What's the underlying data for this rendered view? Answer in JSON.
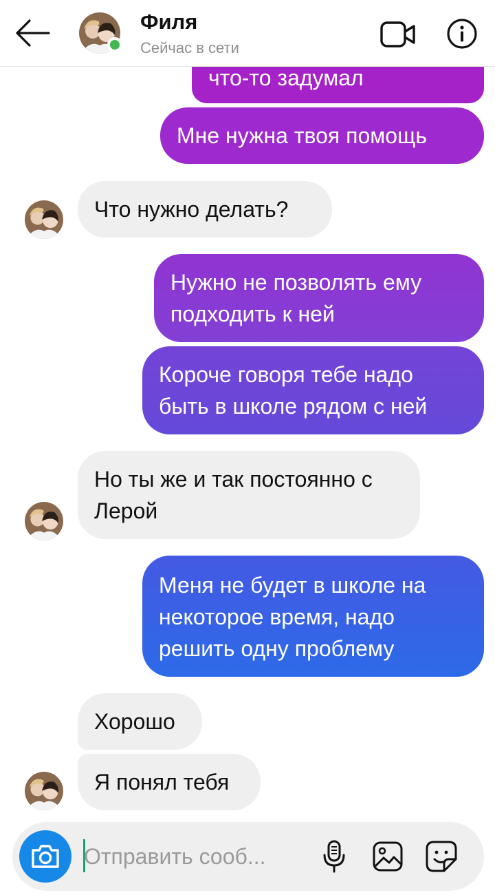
{
  "header": {
    "contact_name": "Филя",
    "status": "Сейчас в сети"
  },
  "messages": [
    {
      "side": "out",
      "text": "что-то задумал",
      "color": "#a522c9"
    },
    {
      "side": "out",
      "text": "Мне нужна твоя помощь",
      "color": "#9d29cf"
    },
    {
      "side": "in",
      "text": "Что нужно делать?"
    },
    {
      "side": "out",
      "text": "Нужно не позволять ему подходить к ней",
      "color": "#8a3bd4"
    },
    {
      "side": "out",
      "text": "Короче говоря тебе надо быть в школе рядом с ней",
      "color": "#6e46d8"
    },
    {
      "side": "in",
      "text": "Но ты же и так постоянно с Лерой"
    },
    {
      "side": "out",
      "text": "Меня не будет в школе на некоторое время, надо решить одну проблему",
      "color": "#3a62e5"
    },
    {
      "side": "in",
      "text": "Хорошо"
    },
    {
      "side": "in",
      "text": "Я понял тебя"
    }
  ],
  "composer": {
    "placeholder": "Отправить сооб..."
  },
  "icons": {
    "back": "arrow-left-icon",
    "video": "video-camera-icon",
    "info": "info-icon",
    "camera": "camera-icon",
    "mic": "microphone-icon",
    "gallery": "image-icon",
    "sticker": "sticker-icon"
  },
  "colors": {
    "online": "#3fb94f",
    "camera_button": "#1688e8",
    "incoming_bubble": "#efefef"
  }
}
